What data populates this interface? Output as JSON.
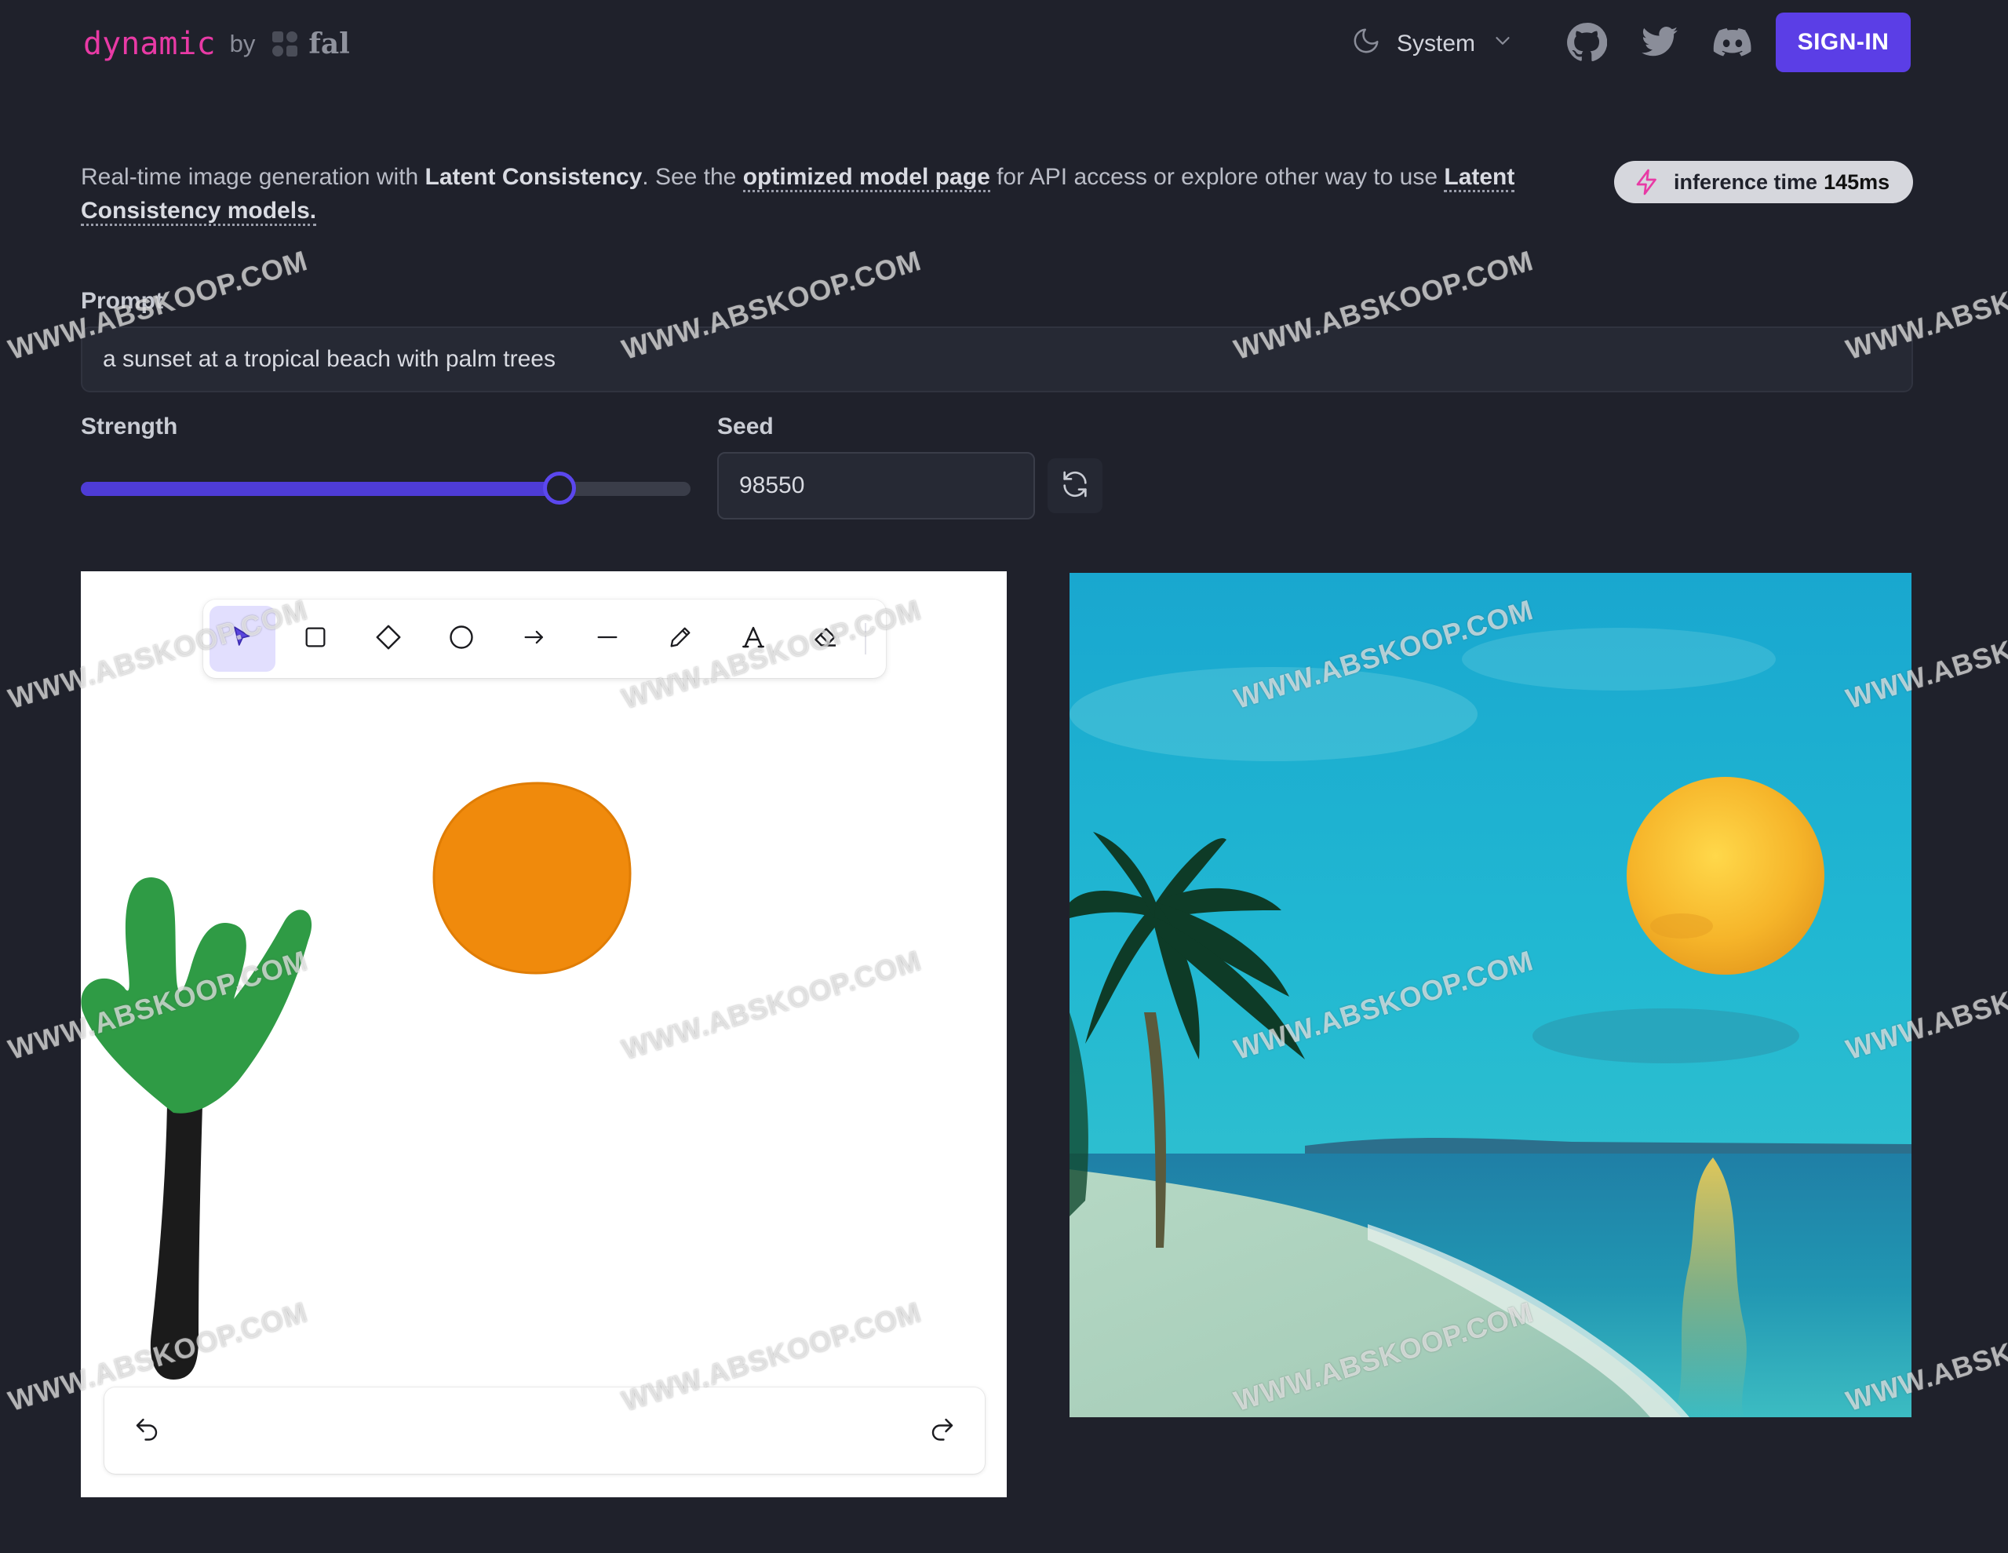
{
  "header": {
    "brand_name": "dynamic",
    "brand_by": "by",
    "brand_partner": "fal",
    "theme_label": "System",
    "sign_in_label": "SIGN-IN",
    "icons": [
      "moon-icon",
      "chevron-down-icon",
      "github-icon",
      "twitter-icon",
      "discord-icon"
    ]
  },
  "intro": {
    "part1": "Real-time image generation with ",
    "bold1": "Latent Consistency",
    "part2": ". See the ",
    "link1": "optimized model page",
    "part3": " for API access or explore other way to use ",
    "link2": "Latent Consistency models."
  },
  "badge": {
    "label": "inference time",
    "value": "145ms"
  },
  "prompt": {
    "label": "Prompt",
    "value": "a sunset at a tropical beach with palm trees"
  },
  "strength": {
    "label": "Strength",
    "value": 0.785
  },
  "seed": {
    "label": "Seed",
    "value": "98550"
  },
  "toolbar": {
    "tools": [
      {
        "name": "selection-tool",
        "icon": "pointer-icon",
        "active": true
      },
      {
        "name": "rectangle-tool",
        "icon": "square-icon"
      },
      {
        "name": "diamond-tool",
        "icon": "diamond-icon"
      },
      {
        "name": "ellipse-tool",
        "icon": "circle-icon"
      },
      {
        "name": "arrow-tool",
        "icon": "arrow-right-icon"
      },
      {
        "name": "line-tool",
        "icon": "line-icon"
      },
      {
        "name": "draw-tool",
        "icon": "pencil-icon"
      },
      {
        "name": "text-tool",
        "icon": "text-icon"
      },
      {
        "name": "eraser-tool",
        "icon": "eraser-icon"
      }
    ]
  },
  "history": {
    "icons": [
      "undo-icon",
      "redo-icon"
    ]
  },
  "colors": {
    "background": "#1f212b",
    "brand": "#e83aa5",
    "accent": "#5b3ee6",
    "sun_drawing": "#f08a0c",
    "palm_leaves": "#2f9b45",
    "palm_trunk": "#1b1b1b"
  },
  "watermark": "WWW.ABSKOOP.COM"
}
